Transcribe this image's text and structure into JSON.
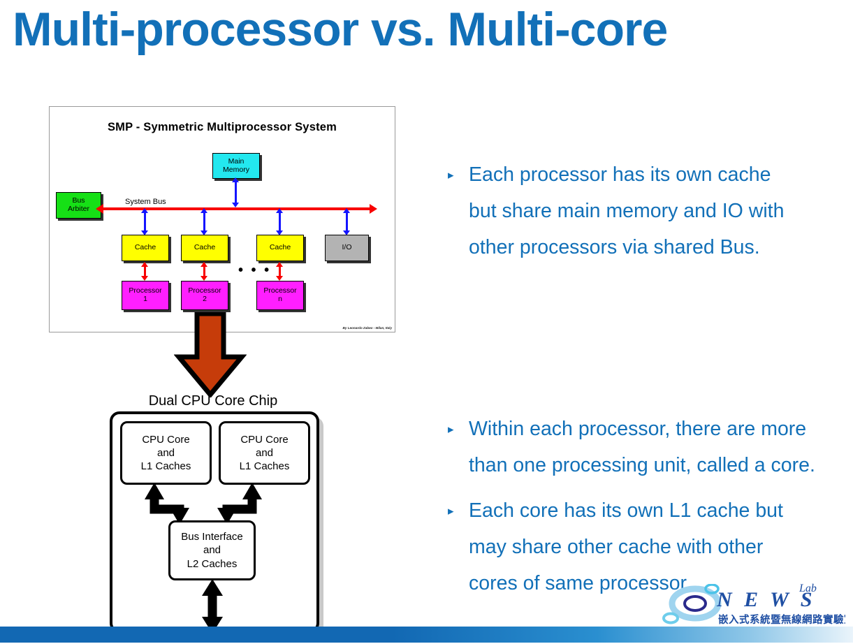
{
  "slide": {
    "title": "Multi-processor vs. Multi-core",
    "title_color": "#1270b8",
    "bullet_marker": "▸"
  },
  "smp_figure": {
    "title": "SMP - Symmetric Multiprocessor System",
    "system_bus_label": "System Bus",
    "ellipsis": "• • •",
    "credit": "By Leonardo Zabeo - Milan, Italy",
    "boxes": {
      "main_memory": {
        "label": "Main\nMemory",
        "line1": "Main",
        "line2": "Memory",
        "color": "#23e8ef"
      },
      "bus_arbiter": {
        "line1": "Bus",
        "line2": "Arbiter",
        "color": "#16e016"
      },
      "io": {
        "label": "I/O",
        "color": "#b3b3b3"
      },
      "caches": [
        {
          "label": "Cache",
          "color": "#ffff00"
        },
        {
          "label": "Cache",
          "color": "#ffff00"
        },
        {
          "label": "Cache",
          "color": "#ffff00"
        }
      ],
      "processors": [
        {
          "line1": "Processor",
          "line2": "1",
          "color": "#ff1fff"
        },
        {
          "line1": "Processor",
          "line2": "2",
          "color": "#ff1fff"
        },
        {
          "line1": "Processor",
          "line2": "n",
          "color": "#ff1fff"
        }
      ]
    },
    "bus_color": "#f80000",
    "link_color": "#1414ff"
  },
  "transition_arrow": {
    "name": "down-arrow",
    "fill": "#c63c0a",
    "stroke": "#000000"
  },
  "dualcore_figure": {
    "label": "Dual CPU Core Chip",
    "core_left": {
      "line1": "CPU Core",
      "line2": "and",
      "line3": "L1 Caches"
    },
    "core_right": {
      "line1": "CPU Core",
      "line2": "and",
      "line3": "L1 Caches"
    },
    "bus_interface": {
      "line1": "Bus Interface",
      "line2": "and",
      "line3": "L2 Caches"
    }
  },
  "bullets": [
    {
      "id": "bullet-1",
      "line1": "Each processor has its own cache",
      "line2": "but share main memory and IO with",
      "line3": "other processors via shared Bus."
    },
    {
      "id": "bullet-2",
      "line1": "Within each processor, there are more",
      "line2": "than one processing unit, called a core."
    },
    {
      "id": "bullet-3",
      "line1": "Each core has its own L1 cache but",
      "line2": "may share other cache with other",
      "line3": "cores of same processor."
    }
  ],
  "logo": {
    "word": "N E W S",
    "superscript": "Lab",
    "chinese": "嵌入式系統暨無線網路實驗室",
    "color": "#1f4fa3"
  },
  "bottom_bar": {
    "color_left": "#1268b3",
    "color_right": "#eaf4fb"
  }
}
